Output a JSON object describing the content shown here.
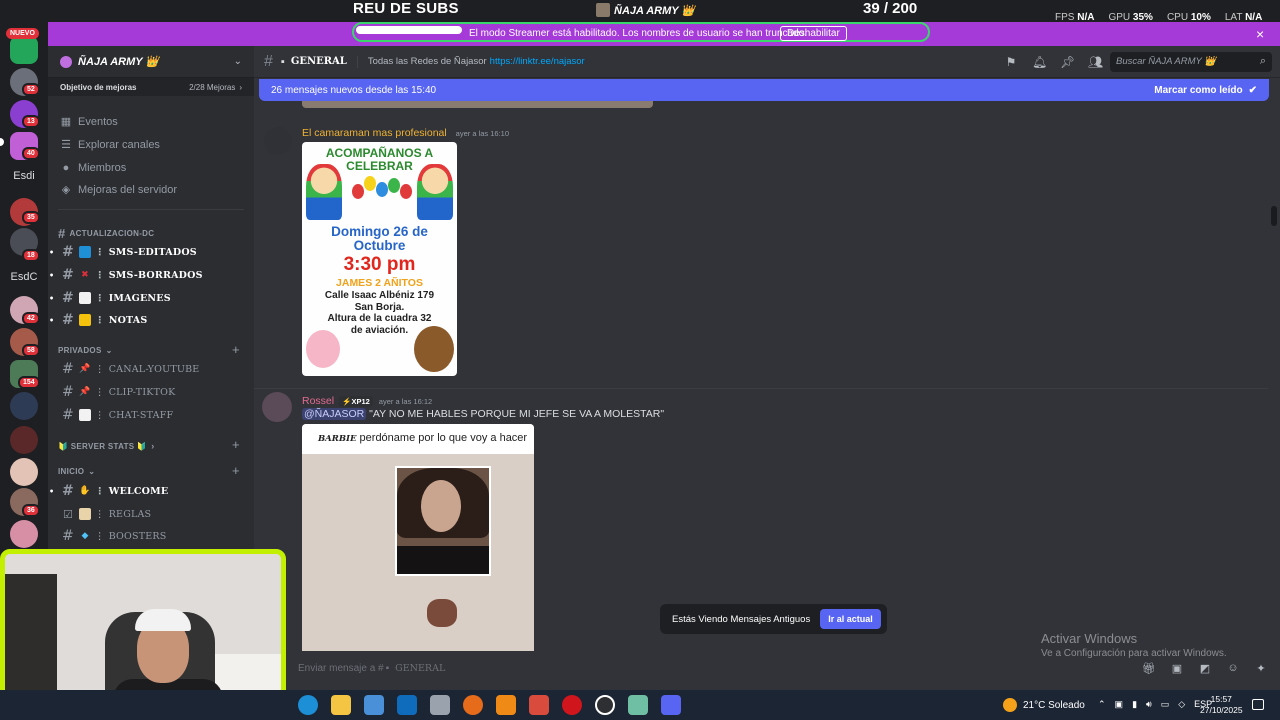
{
  "stream_overlay": {
    "subs_title": "REU DE SUBS",
    "brand": "ÑAJA ARMY 👑",
    "subs_count": "39  / 200",
    "fps_label": "FPS",
    "fps_value": "N/A",
    "gpu_label": "GPU",
    "gpu_value": "35%",
    "cpu_label": "CPU",
    "cpu_value": "10%",
    "lat_label": "LAT",
    "lat_value": "N/A"
  },
  "streamer_banner": {
    "text": "El modo Streamer está habilitado. Los nombres de usuario se han truncado.",
    "disable_label": "Deshabilitar",
    "close_icon": "×"
  },
  "server_rail": {
    "new_badge": "NUEVO",
    "text_servers": [
      "Esdi",
      "EsdC"
    ],
    "badges": [
      "52",
      "13",
      "40",
      "35",
      "18",
      "42",
      "58",
      "154",
      "36"
    ]
  },
  "sidebar": {
    "server_name": "ÑAJA ARMY 👑",
    "boost_goal_label": "Objetivo de mejoras",
    "boost_goal_value": "2/28 Mejoras",
    "nav": [
      "Eventos",
      "Explorar canales",
      "Miembros",
      "Mejoras del servidor"
    ],
    "categories": {
      "actualizacion": "ACTUALIZACION-DC",
      "privados": "PRIVADOS",
      "server_stats": "🔰 SERVER STATS 🔰",
      "inicio": "INICIO"
    },
    "channels_actualizacion": [
      {
        "name": "SMS-EDITADOS",
        "emoji": "🔄"
      },
      {
        "name": "SMS-BORRADOS",
        "emoji": "✖"
      },
      {
        "name": "IMAGENES",
        "emoji": "⬜"
      },
      {
        "name": "NOTAS",
        "emoji": "🟨"
      }
    ],
    "channels_privados": [
      {
        "name": "CANAL-YOUTUBE",
        "emoji": "📌"
      },
      {
        "name": "CLIP-TIKTOK",
        "emoji": "📌"
      },
      {
        "name": "CHAT-STAFF",
        "emoji": "⬜"
      }
    ],
    "channels_inicio": [
      {
        "name": "WELCOME",
        "emoji": "👋"
      },
      {
        "name": "REGLAS",
        "emoji": "📜"
      },
      {
        "name": "BOOSTERS",
        "emoji": "💎"
      }
    ]
  },
  "header": {
    "channel_name": "GENERAL",
    "topic": "Todas las Redes de Ñajasor",
    "topic_link": "https://linktr.ee/najasor",
    "search_placeholder": "Buscar ÑAJA ARMY 👑"
  },
  "new_messages_bar": {
    "text": "26 mensajes nuevos desde las 15:40",
    "mark_read": "Marcar como leído"
  },
  "messages": [
    {
      "author": "El camaraman mas profesional",
      "timestamp": "ayer a las 16:10",
      "poster": {
        "line1": "ACOMPAÑANOS A\nCELEBRAR",
        "line2": "Domingo 26 de\nOctubre",
        "line3": "3:30 pm",
        "line4": "JAMES 2 AÑITOS",
        "line5": "Calle Isaac Albéniz 179\nSan Borja.\nAltura de la cuadra  32\nde aviación."
      }
    },
    {
      "author": "Rossel",
      "tag": "⚡XP12",
      "timestamp": "ayer a las 16:12",
      "mention": "@ÑAJASOR",
      "text": " \"AY NO ME HABLES PORQUE MI JEFE SE VA A MOLESTAR\"",
      "meme_caption_brand": "BARBIE",
      "meme_caption": " perdóname por lo que voy a hacer"
    }
  ],
  "old_messages_toast": {
    "text": "Estás Viendo Mensajes Antiguos",
    "button": "Ir al actual"
  },
  "composer": {
    "placeholder": "Enviar mensaje a #",
    "channel": "GENERAL"
  },
  "windows_watermark": {
    "title": "Activar Windows",
    "subtitle": "Ve a Configuración para activar Windows."
  },
  "taskbar": {
    "weather": "21°C  Soleado",
    "language": "ESP",
    "time": "15:57",
    "date": "27/10/2025"
  },
  "colors": {
    "banner": "#a53ad8",
    "blurple": "#5865f2",
    "webcam_border": "#c3f000",
    "author1": "#f0b232",
    "author2": "#e46b8f"
  }
}
